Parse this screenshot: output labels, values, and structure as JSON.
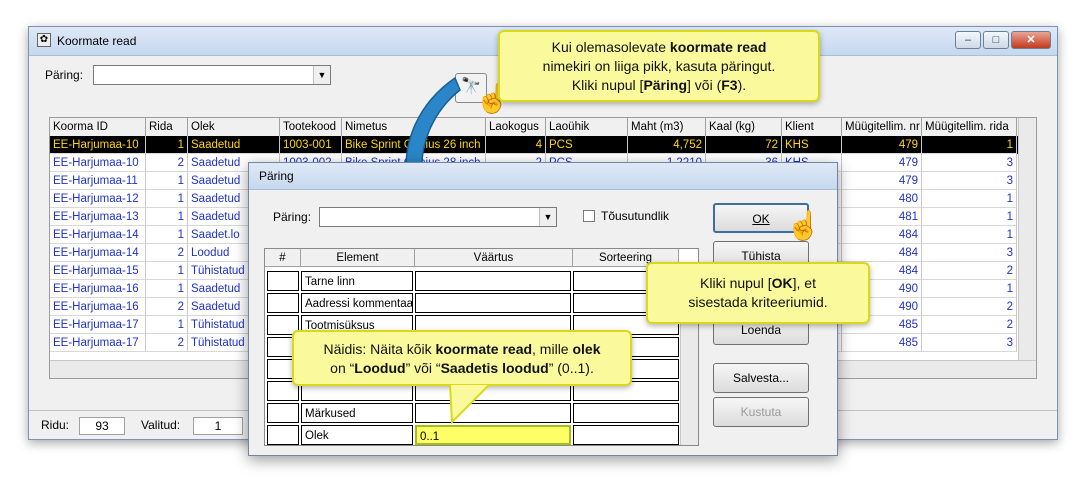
{
  "window": {
    "title": "Koormate read",
    "query_label": "Päring:",
    "query_value": ""
  },
  "grid": {
    "columns": [
      "Koorma ID",
      "Rida",
      "Olek",
      "Tootekood",
      "Nimetus",
      "Laokogus",
      "Laoühik",
      "Maht (m3)",
      "Kaal (kg)",
      "Klient",
      "Müügitellim. nr",
      "Müügitellim. rida"
    ],
    "rows": [
      [
        "EE-Harjumaa-10",
        "1",
        "Saadetud",
        "1003-001",
        "Bike Sprint Genius 26 inch",
        "4",
        "PCS",
        "4,752",
        "72",
        "KHS",
        "479",
        "1"
      ],
      [
        "EE-Harjumaa-10",
        "2",
        "Saadetud",
        "1003-002",
        "Bike Sprint Genius 28 inch",
        "2",
        "PCS",
        "1,2210",
        "36",
        "KHS",
        "479",
        "3"
      ],
      [
        "EE-Harjumaa-11",
        "1",
        "Saadetud",
        "",
        "",
        "",
        "",
        "",
        "",
        "",
        "479",
        "3"
      ],
      [
        "EE-Harjumaa-12",
        "1",
        "Saadetud",
        "",
        "",
        "",
        "",
        "",
        "",
        "",
        "480",
        "1"
      ],
      [
        "EE-Harjumaa-13",
        "1",
        "Saadetud",
        "",
        "",
        "",
        "",
        "",
        "",
        "",
        "481",
        "1"
      ],
      [
        "EE-Harjumaa-14",
        "1",
        "Saadet.lo",
        "",
        "",
        "",
        "",
        "",
        "",
        "",
        "484",
        "1"
      ],
      [
        "EE-Harjumaa-14",
        "2",
        "Loodud",
        "",
        "",
        "",
        "",
        "",
        "",
        "",
        "484",
        "3"
      ],
      [
        "EE-Harjumaa-15",
        "1",
        "Tühistatud",
        "",
        "",
        "",
        "",
        "",
        "",
        "",
        "484",
        "2"
      ],
      [
        "EE-Harjumaa-16",
        "1",
        "Saadetud",
        "",
        "",
        "",
        "",
        "",
        "",
        "",
        "490",
        "1"
      ],
      [
        "EE-Harjumaa-16",
        "2",
        "Saadetud",
        "",
        "",
        "",
        "",
        "",
        "",
        "",
        "490",
        "2"
      ],
      [
        "EE-Harjumaa-17",
        "1",
        "Tühistatud",
        "",
        "",
        "",
        "",
        "",
        "",
        "",
        "485",
        "2"
      ],
      [
        "EE-Harjumaa-17",
        "2",
        "Tühistatud",
        "",
        "",
        "",
        "",
        "",
        "",
        "",
        "485",
        "3"
      ]
    ]
  },
  "status": {
    "rows_label": "Ridu:",
    "rows_value": "93",
    "selected_label": "Valitud:",
    "selected_value": "1"
  },
  "dialog": {
    "title": "Päring",
    "query_label": "Päring:",
    "checkbox_label": "Tõusutundlik",
    "headers": [
      "#",
      "Element",
      "Väärtus",
      "Sorteering"
    ],
    "rows": [
      {
        "element": "Tarne linn",
        "value": ""
      },
      {
        "element": "Aadressi kommentaa",
        "value": ""
      },
      {
        "element": "Tootmisüksus",
        "value": ""
      },
      {
        "element": "",
        "value": ""
      },
      {
        "element": "",
        "value": ""
      },
      {
        "element": "",
        "value": ""
      },
      {
        "element": "Märkused",
        "value": ""
      },
      {
        "element": "Olek",
        "value": "0..1"
      }
    ],
    "buttons": {
      "ok": "OK",
      "clear": "Tühista",
      "load": "Loenda",
      "save": "Salvesta...",
      "delete": "Kustuta"
    }
  },
  "callouts": {
    "top": {
      "p1": "Kui olemasolevate ",
      "b1": "koormate read",
      "p2": "nimekiri on liiga pikk, kasuta päringut.",
      "p3": "Kliki nupul [",
      "b2": "Päring",
      "p4": "] või (",
      "b3": "F3",
      "p5": ")."
    },
    "ok": {
      "p1": "Kliki nupul [",
      "b1": "OK",
      "p2": "], et",
      "p3": "sisestada kriteeriumid."
    },
    "example": {
      "p1": "Näidis: Näita kõik ",
      "b1": "koormate read",
      "p2": ", mille ",
      "b2": "olek",
      "p3": "on “",
      "b3": "Loodud",
      "p4": "” või “",
      "b4": "Saadetis loodud",
      "p5": "” (0..1)."
    }
  }
}
